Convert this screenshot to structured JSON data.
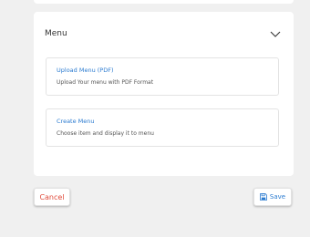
{
  "menu": {
    "title": "Menu",
    "options": [
      {
        "title": "Upload Menu (PDF)",
        "description": "Upload Your menu with PDF Format"
      },
      {
        "title": "Create Menu",
        "description": "Choose item and display it to menu"
      }
    ]
  },
  "actions": {
    "cancel_label": "Cancel",
    "save_label": "Save"
  },
  "icons": {
    "collapse": "chevron-down-icon",
    "save": "floppy-disk-icon"
  },
  "colors": {
    "link": "#2b7bd0",
    "cancel": "#e04a3a",
    "background": "#f0f0f0",
    "card": "#ffffff"
  }
}
